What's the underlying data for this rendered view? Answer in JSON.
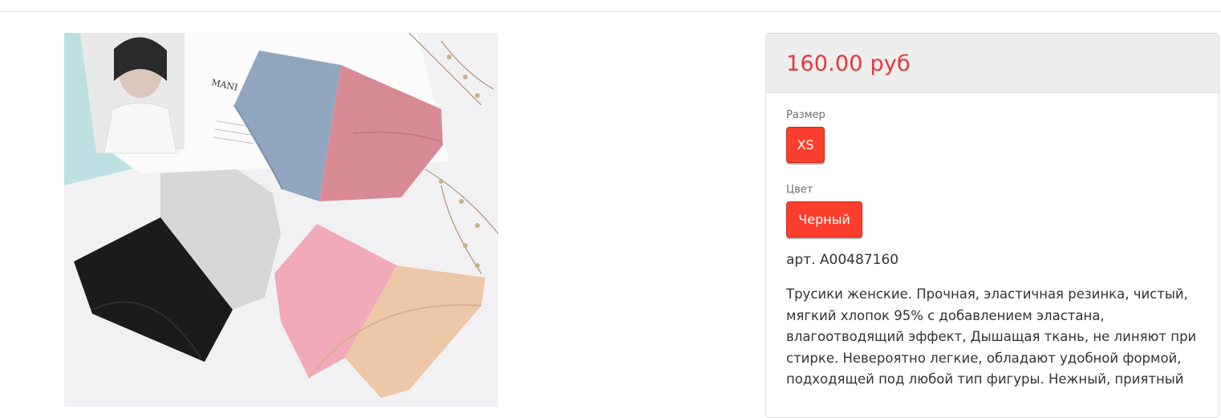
{
  "product": {
    "price": "160.00 руб",
    "size_label": "Размер",
    "size_value": "XS",
    "color_label": "Цвет",
    "color_value": "Черный",
    "sku": "арт. A00487160",
    "description": "Трусики женские. Прочная, эластичная резинка, чистый, мягкий хлопок 95% с добавлением эластана, влагоотводящий эффект, Дышащая ткань, не линяют при стирке. Невероятно легкие, обладают удобной формой, подходящей под любой тип фигуры. Нежный, приятный"
  },
  "image": {
    "magazine_text": "MANI"
  },
  "colors": {
    "price": "#e8363b",
    "button": "#fb3f2c",
    "panel_header": "#eeeeee"
  }
}
